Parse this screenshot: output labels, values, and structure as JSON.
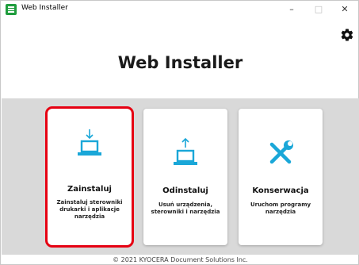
{
  "window": {
    "title": "Web Installer",
    "minimize_label": "–",
    "maximize_label": "□",
    "close_label": "✕"
  },
  "header": {
    "heading": "Web Installer",
    "settings_icon": "gear-icon"
  },
  "cards": [
    {
      "title": "Zainstaluj",
      "description": "Zainstaluj sterowniki drukarki i aplikacje narzędzia",
      "icon": "laptop-download-icon",
      "selected": true
    },
    {
      "title": "Odinstaluj",
      "description": "Usuń urządzenia, sterowniki i narzędzia",
      "icon": "laptop-upload-icon",
      "selected": false
    },
    {
      "title": "Konserwacja",
      "description": "Uruchom programy narzędzia",
      "icon": "tools-icon",
      "selected": false
    }
  ],
  "footer": {
    "copyright": "© 2021 KYOCERA Document Solutions Inc."
  },
  "colors": {
    "accent": "#1aa7d8",
    "selected_border": "#e60012",
    "band": "#d9d9d9"
  }
}
